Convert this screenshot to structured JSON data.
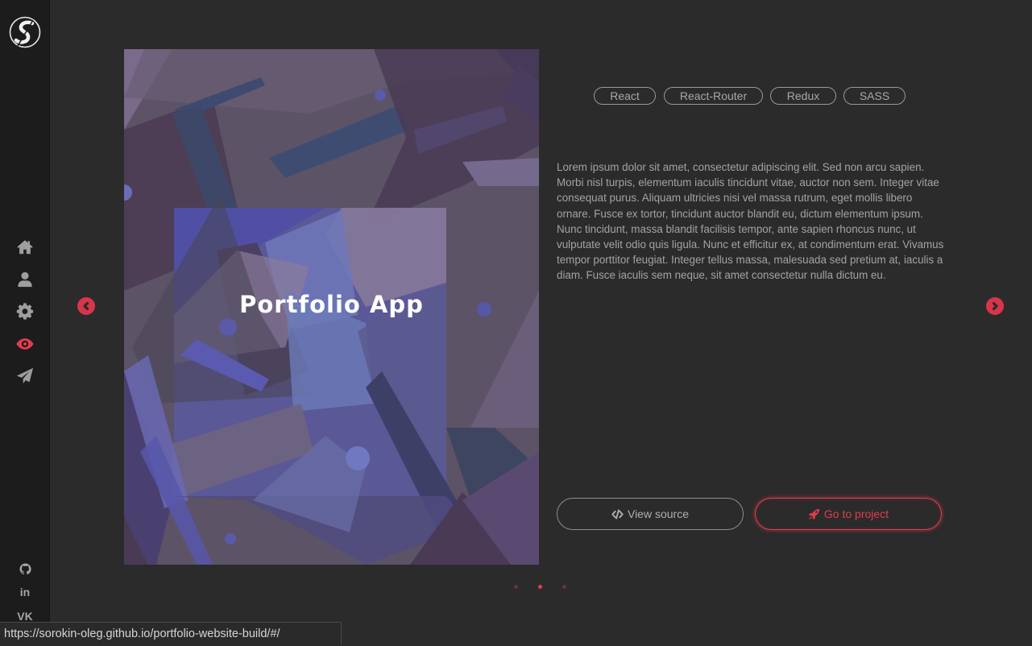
{
  "sidebar": {
    "logo_icon": "logo-s-icon",
    "nav": [
      {
        "icon": "home-icon",
        "label": "Home",
        "active": false
      },
      {
        "icon": "user-icon",
        "label": "About",
        "active": false
      },
      {
        "icon": "gear-icon",
        "label": "Skills",
        "active": false
      },
      {
        "icon": "eye-icon",
        "label": "Portfolio",
        "active": true
      },
      {
        "icon": "paper-plane-icon",
        "label": "Contact",
        "active": false
      }
    ],
    "social": [
      {
        "icon": "github-icon"
      },
      {
        "icon": "linkedin-icon",
        "text": "in"
      },
      {
        "icon": "vk-icon",
        "text": "VK"
      }
    ]
  },
  "project": {
    "title": "Portfolio App",
    "tags": [
      "React",
      "React-Router",
      "Redux",
      "SASS"
    ],
    "description": "Lorem ipsum dolor sit amet, consectetur adipiscing elit. Sed non arcu sapien. Morbi nisl turpis, elementum iaculis tincidunt vitae, auctor non sem. Integer vitae consequat purus. Aliquam ultricies nisi vel massa rutrum, eget mollis libero ornare. Fusce ex tortor, tincidunt auctor blandit eu, dictum elementum ipsum. Nunc tincidunt, massa blandit facilisis tempor, ante sapien rhoncus nunc, ut vulputate velit odio quis ligula. Nunc et efficitur ex, at condimentum erat. Vivamus tempor porttitor feugiat. Integer tellus massa, malesuada sed pretium at, iaculis a diam. Fusce iaculis sem neque, sit amet consectetur nulla dictum eu.",
    "view_source_label": "View source",
    "view_source_icon": "code-icon",
    "go_to_project_label": "Go to project",
    "go_to_project_icon": "rocket-icon"
  },
  "carousel": {
    "prev_icon": "chevron-left-icon",
    "next_icon": "chevron-right-icon",
    "slide_count": 3,
    "active_slide": 2
  },
  "status_bar": {
    "url": "https://sorokin-oleg.github.io/portfolio-website-build/#/"
  },
  "colors": {
    "background": "#2b2b2b",
    "sidebar": "#1c1c1c",
    "accent": "#e23c4f",
    "text": "#a3a3a3"
  }
}
